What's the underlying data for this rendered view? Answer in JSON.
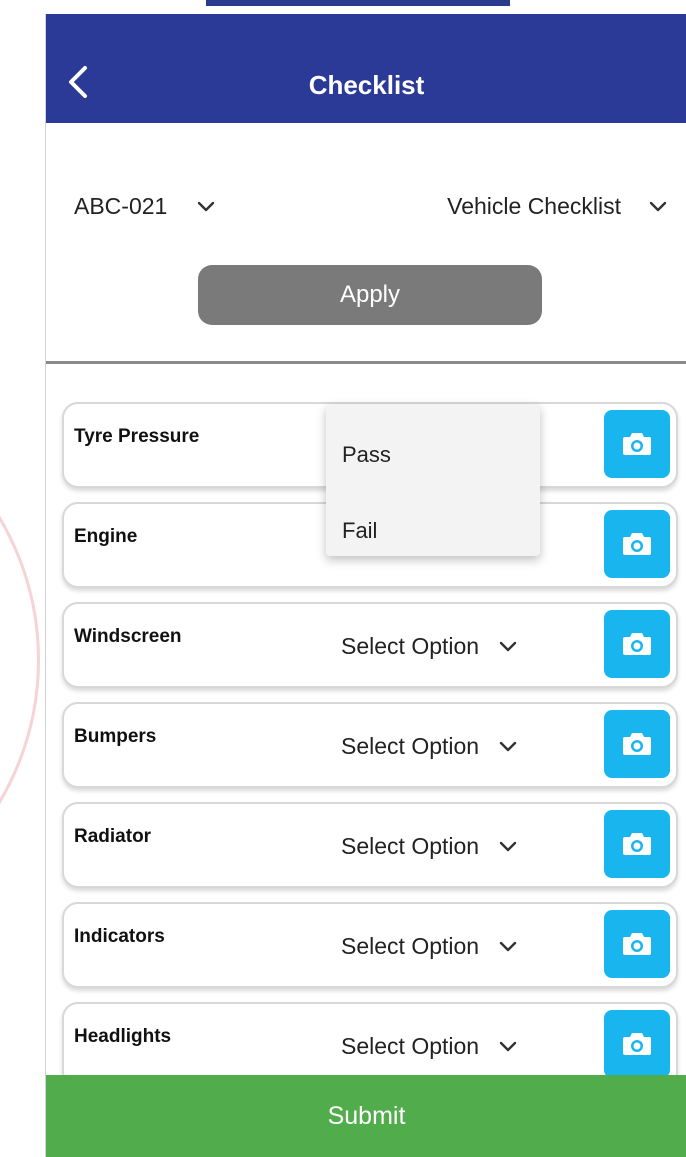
{
  "header": {
    "title": "Checklist",
    "back_icon": "chevron-left-icon"
  },
  "filters": {
    "vehicle_value": "ABC-021",
    "checklist_type_value": "Vehicle Checklist",
    "apply_label": "Apply"
  },
  "checklist": {
    "items": [
      {
        "label": "Tyre Pressure",
        "select": ""
      },
      {
        "label": "Engine",
        "select": ""
      },
      {
        "label": "Windscreen",
        "select": "Select Option"
      },
      {
        "label": "Bumpers",
        "select": "Select Option"
      },
      {
        "label": "Radiator",
        "select": "Select Option"
      },
      {
        "label": "Indicators",
        "select": "Select Option"
      },
      {
        "label": "Headlights",
        "select": "Select Option"
      }
    ],
    "camera_icon": "camera-icon"
  },
  "dropdown": {
    "options": [
      "Pass",
      "Fail"
    ]
  },
  "footer": {
    "submit_label": "Submit"
  },
  "colors": {
    "appbar": "#2b3a96",
    "camera_button": "#18b5ef",
    "apply_button": "#7a7a7a",
    "submit_button": "#51ad4b"
  }
}
